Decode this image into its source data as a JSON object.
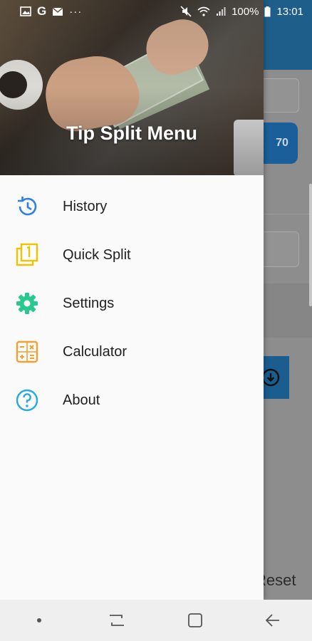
{
  "status_bar": {
    "icons_left": [
      "image-icon",
      "google-icon",
      "mail-icon",
      "more-icon"
    ],
    "more": "···",
    "battery_percent": "100%",
    "time": "13:01"
  },
  "background_app": {
    "pill_value": "70",
    "reset_label": "Reset"
  },
  "drawer": {
    "title": "Tip Split Menu",
    "items": [
      {
        "label": "History",
        "icon": "history-icon",
        "color": "#2f7fe8"
      },
      {
        "label": "Quick Split",
        "icon": "quick-split-icon",
        "color": "#f2c200"
      },
      {
        "label": "Settings",
        "icon": "gear-icon",
        "color": "#28c98f"
      },
      {
        "label": "Calculator",
        "icon": "calculator-icon",
        "color": "#f3a033"
      },
      {
        "label": "About",
        "icon": "help-icon",
        "color": "#29a8e0"
      }
    ]
  },
  "nav_bar": {
    "buttons": [
      "dot-icon",
      "recents-icon",
      "home-icon",
      "back-icon"
    ]
  }
}
